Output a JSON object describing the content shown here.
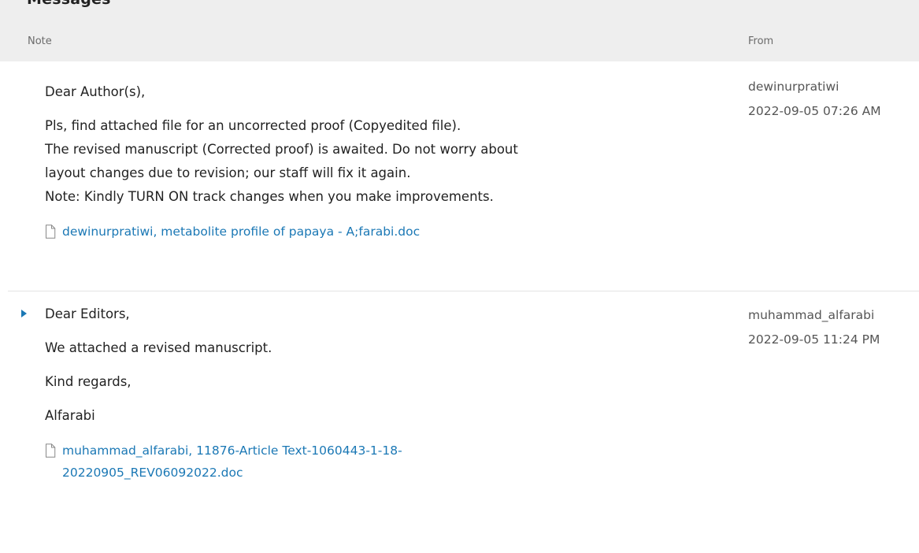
{
  "panel": {
    "title": "Messages",
    "columns": {
      "note": "Note",
      "from": "From"
    }
  },
  "messages": [
    {
      "greeting": "Dear Author(s),",
      "lines": [
        "Pls, find attached file for an uncorrected proof (Copyedited file).",
        "The revised manuscript (Corrected proof) is awaited. Do not worry about",
        "layout changes due to revision; our staff will fix it again.",
        "Note: Kindly TURN ON track changes when you make improvements."
      ],
      "attachment": "dewinurpratiwi, metabolite profile of papaya - A;farabi.doc",
      "from_user": "dewinurpratiwi",
      "from_date": "2022-09-05 07:26 AM"
    },
    {
      "greeting": "Dear Editors,",
      "lines": [
        "We attached a revised manuscript.",
        "Kind regards,",
        "Alfarabi"
      ],
      "attachment_line1": "muhammad_alfarabi, 11876-Article Text-1060443-1-18-",
      "attachment_line2": "20220905_REV06092022.doc",
      "from_user": "muhammad_alfarabi",
      "from_date": "2022-09-05 11:24 PM"
    }
  ],
  "colors": {
    "header_bg": "#eeeeee",
    "link": "#1b78b5",
    "text": "#222222",
    "muted": "#6b6b6b"
  },
  "icons": {
    "attachment": "file-icon",
    "expand": "triangle-right-icon"
  }
}
